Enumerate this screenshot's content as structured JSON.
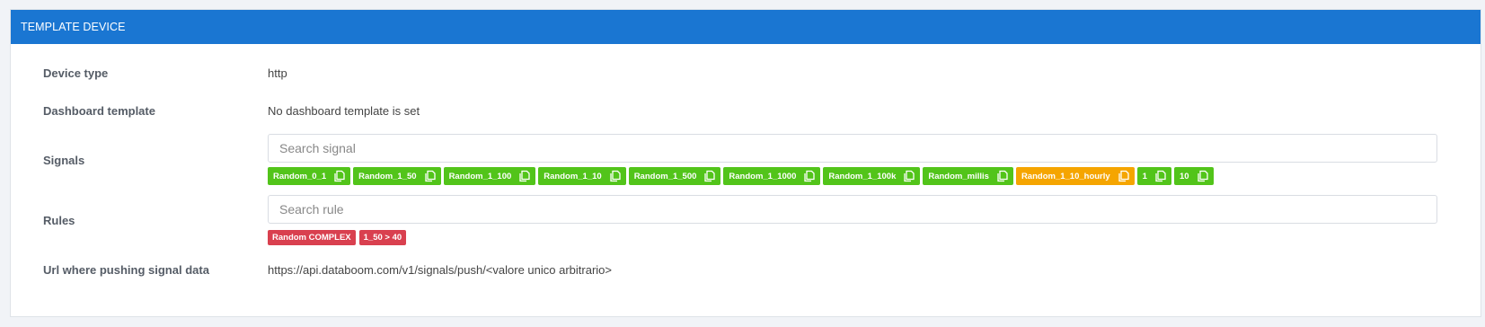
{
  "panel": {
    "title": "TEMPLATE DEVICE"
  },
  "device_type": {
    "label": "Device type",
    "value": "http"
  },
  "dashboard_template": {
    "label": "Dashboard template",
    "value": "No dashboard template is set"
  },
  "signals": {
    "label": "Signals",
    "placeholder": "Search signal",
    "items": [
      {
        "name": "Random_0_1",
        "color": "#52c41a"
      },
      {
        "name": "Random_1_50",
        "color": "#52c41a"
      },
      {
        "name": "Random_1_100",
        "color": "#52c41a"
      },
      {
        "name": "Random_1_10",
        "color": "#52c41a"
      },
      {
        "name": "Random_1_500",
        "color": "#52c41a"
      },
      {
        "name": "Random_1_1000",
        "color": "#52c41a"
      },
      {
        "name": "Random_1_100k",
        "color": "#52c41a"
      },
      {
        "name": "Random_millis",
        "color": "#52c41a"
      },
      {
        "name": "Random_1_10_hourly",
        "color": "#f5a500"
      },
      {
        "name": "1",
        "color": "#52c41a"
      },
      {
        "name": "10",
        "color": "#52c41a"
      }
    ],
    "tag_icon": "copy-icon"
  },
  "rules": {
    "label": "Rules",
    "placeholder": "Search rule",
    "items": [
      {
        "name": "Random COMPLEX",
        "color": "#d9404f"
      },
      {
        "name": "1_50 > 40",
        "color": "#d9404f"
      }
    ]
  },
  "push_url": {
    "label": "Url where pushing signal data",
    "value": "https://api.databoom.com/v1/signals/push/<valore unico arbitrario>"
  },
  "colors": {
    "header": "#1a76d2",
    "signal_green": "#52c41a",
    "signal_orange": "#f5a500",
    "rule_red": "#d9404f"
  }
}
